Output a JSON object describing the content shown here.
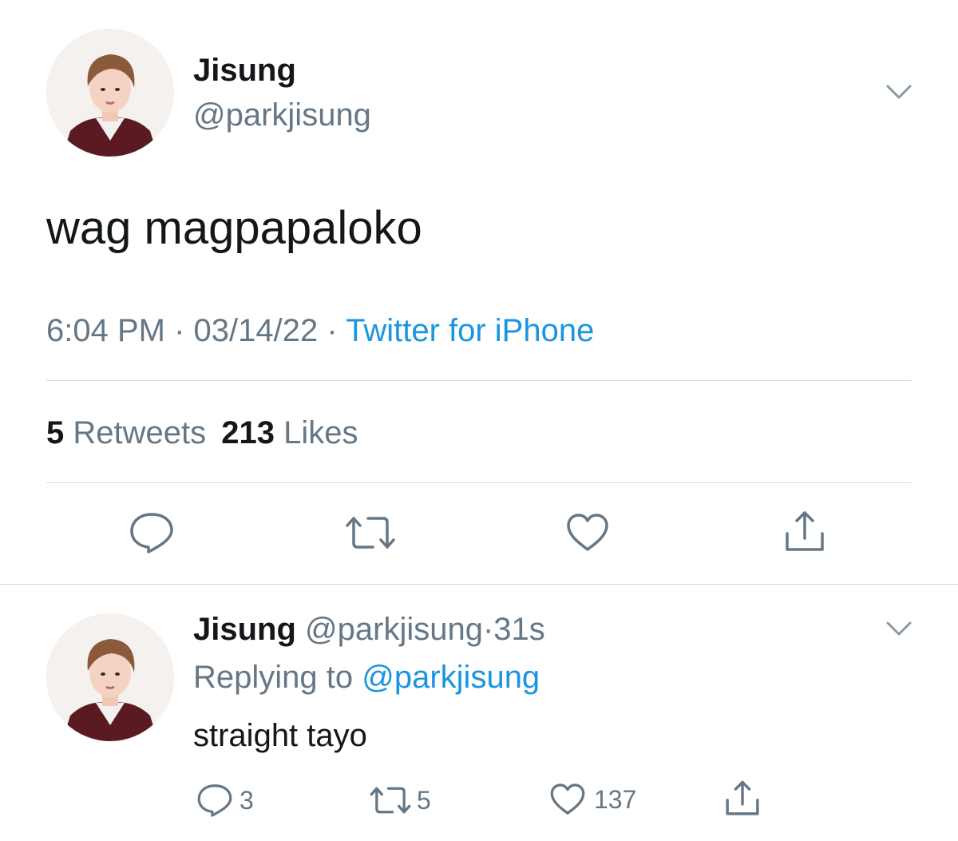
{
  "main_tweet": {
    "display_name": "Jisung",
    "handle": "@parkjisung",
    "text": "wag magpapaloko",
    "time": "6:04 PM",
    "separator": "·",
    "date": "03/14/22",
    "source": "Twitter for iPhone",
    "stats": {
      "retweets_count": "5",
      "retweets_label": "Retweets",
      "likes_count": "213",
      "likes_label": "Likes"
    },
    "actions": {
      "reply_icon": "reply-icon",
      "retweet_icon": "retweet-icon",
      "like_icon": "heart-icon",
      "share_icon": "share-icon"
    }
  },
  "reply_tweet": {
    "display_name": "Jisung",
    "handle": "@parkjisung",
    "separator": "·",
    "age": "31s",
    "replying_label": "Replying to",
    "replying_handle": "@parkjisung",
    "text": "straight tayo",
    "actions": {
      "reply_count": "3",
      "retweet_count": "5",
      "like_count": "137"
    }
  },
  "colors": {
    "text": "#14171a",
    "muted": "#657786",
    "link": "#1b95e0",
    "divider": "#d9dde1"
  }
}
